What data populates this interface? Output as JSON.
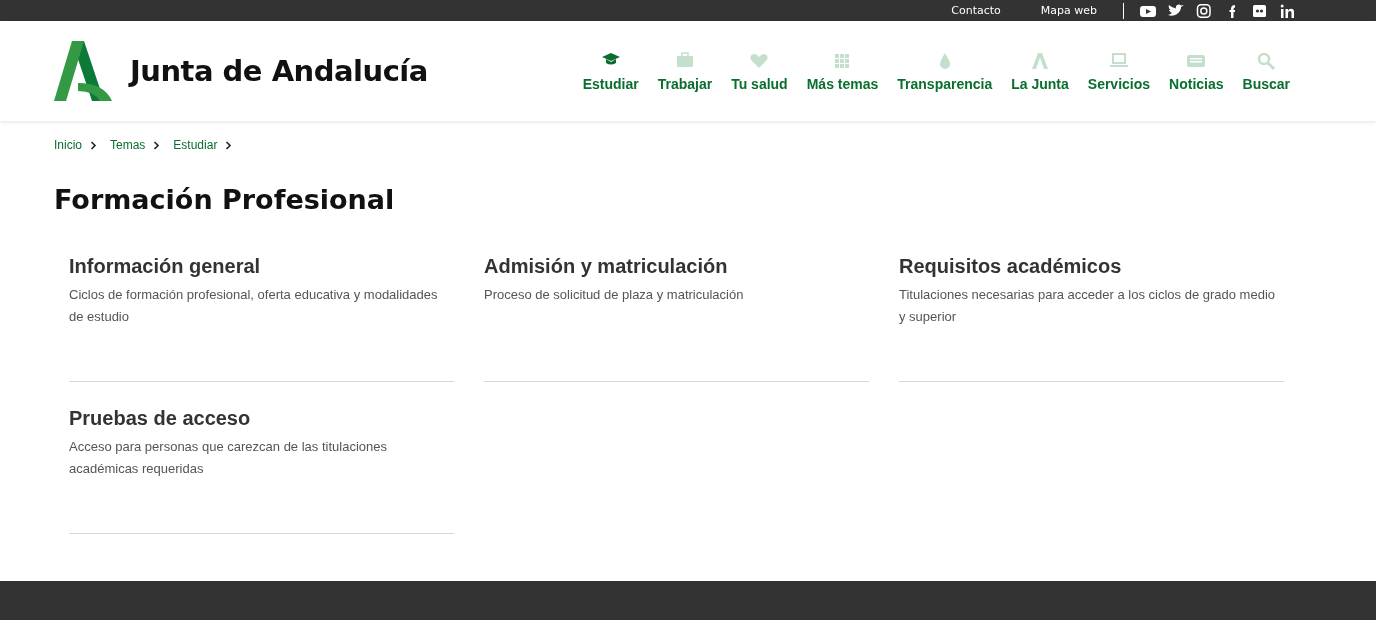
{
  "top_bar": {
    "links": [
      "Contacto",
      "Mapa web"
    ]
  },
  "header": {
    "logo_text": "Junta de Andalucía",
    "nav": [
      {
        "label": "Estudiar",
        "selected": true
      },
      {
        "label": "Trabajar",
        "selected": false
      },
      {
        "label": "Tu salud",
        "selected": false
      },
      {
        "label": "Más temas",
        "selected": false
      },
      {
        "label": "Transparencia",
        "selected": false
      },
      {
        "label": "La Junta",
        "selected": false
      },
      {
        "label": "Servicios",
        "selected": false
      },
      {
        "label": "Noticias",
        "selected": false
      },
      {
        "label": "Buscar",
        "selected": false
      }
    ]
  },
  "breadcrumb": [
    "Inicio",
    "Temas",
    "Estudiar"
  ],
  "title": "Formación Profesional",
  "cards": [
    {
      "title": "Información general",
      "description": "Ciclos de formación profesional, oferta educativa y modalidades de estudio"
    },
    {
      "title": "Admisión y matriculación",
      "description": "Proceso de solicitud de plaza y matriculación"
    },
    {
      "title": "Requisitos académicos",
      "description": "Titulaciones necesarias para acceder a los ciclos de grado medio y superior"
    },
    {
      "title": "Pruebas de acceso",
      "description": "Acceso para personas que carezcan de las titulaciones académicas requeridas"
    }
  ]
}
